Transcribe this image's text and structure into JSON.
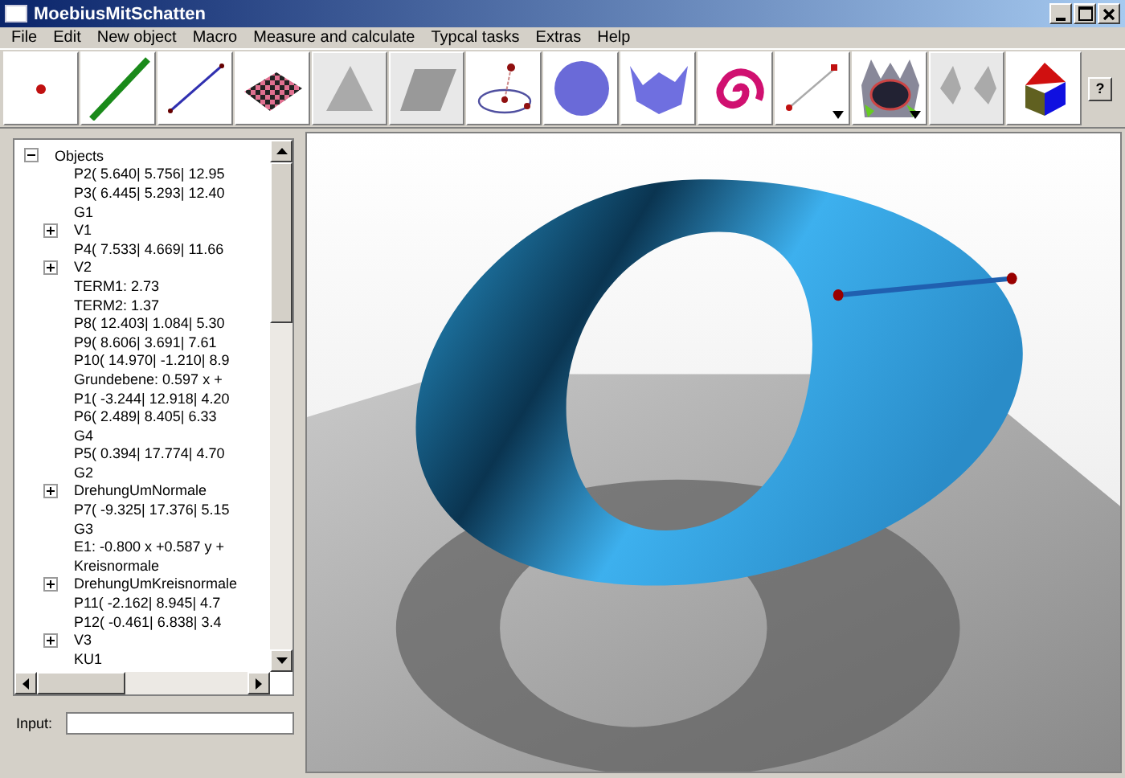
{
  "window": {
    "title": "MoebiusMitSchatten"
  },
  "menu": [
    "File",
    "Edit",
    "New object",
    "Macro",
    "Measure and calculate",
    "Typcal tasks",
    "Extras",
    "Help"
  ],
  "toolbar": {
    "tools": [
      {
        "kind": "point",
        "has_menu": false
      },
      {
        "kind": "line",
        "has_menu": false
      },
      {
        "kind": "segment",
        "has_menu": false
      },
      {
        "kind": "checker-plane",
        "has_menu": false
      },
      {
        "kind": "triangle",
        "has_menu": false
      },
      {
        "kind": "parallelogram",
        "has_menu": false
      },
      {
        "kind": "circle",
        "has_menu": false
      },
      {
        "kind": "sphere",
        "has_menu": false
      },
      {
        "kind": "surface",
        "has_menu": false
      },
      {
        "kind": "spiral",
        "has_menu": false
      },
      {
        "kind": "vector",
        "has_menu": true
      },
      {
        "kind": "textured-surface",
        "has_menu": true
      },
      {
        "kind": "pyramids",
        "has_menu": false
      },
      {
        "kind": "cube",
        "has_menu": false
      }
    ],
    "help": "?"
  },
  "tree": {
    "label": "Objects",
    "expanded": true,
    "children": [
      {
        "label": "P2( 5.640| 5.756| 12.95",
        "kind": "leaf"
      },
      {
        "label": "P3( 6.445| 5.293| 12.40",
        "kind": "leaf"
      },
      {
        "label": "G1",
        "kind": "leaf"
      },
      {
        "label": "V1",
        "kind": "group",
        "expanded": false
      },
      {
        "label": "P4( 7.533| 4.669| 11.66",
        "kind": "leaf"
      },
      {
        "label": "V2",
        "kind": "group",
        "expanded": false
      },
      {
        "label": "TERM1: 2.73",
        "kind": "leaf"
      },
      {
        "label": "TERM2: 1.37",
        "kind": "leaf"
      },
      {
        "label": "P8( 12.403| 1.084| 5.30",
        "kind": "leaf"
      },
      {
        "label": "P9( 8.606| 3.691| 7.61",
        "kind": "leaf"
      },
      {
        "label": "P10( 14.970| -1.210| 8.9",
        "kind": "leaf"
      },
      {
        "label": "Grundebene:  0.597 x +",
        "kind": "leaf"
      },
      {
        "label": "P1( -3.244| 12.918| 4.20",
        "kind": "leaf"
      },
      {
        "label": "P6( 2.489| 8.405| 6.33",
        "kind": "leaf"
      },
      {
        "label": "G4",
        "kind": "leaf"
      },
      {
        "label": "P5( 0.394| 17.774| 4.70",
        "kind": "leaf"
      },
      {
        "label": "G2",
        "kind": "leaf"
      },
      {
        "label": "DrehungUmNormale",
        "kind": "group",
        "expanded": false
      },
      {
        "label": "P7( -9.325| 17.376| 5.15",
        "kind": "leaf"
      },
      {
        "label": "G3",
        "kind": "leaf"
      },
      {
        "label": "E1:  -0.800 x +0.587 y +",
        "kind": "leaf"
      },
      {
        "label": "Kreisnormale",
        "kind": "leaf"
      },
      {
        "label": "DrehungUmKreisnormale",
        "kind": "group",
        "expanded": false
      },
      {
        "label": "P11( -2.162| 8.945| 4.7",
        "kind": "leaf"
      },
      {
        "label": "P12( -0.461| 6.838| 3.4",
        "kind": "leaf"
      },
      {
        "label": "V3",
        "kind": "group",
        "expanded": false
      },
      {
        "label": "KU1",
        "kind": "leaf"
      }
    ]
  },
  "input": {
    "label": "Input:"
  }
}
